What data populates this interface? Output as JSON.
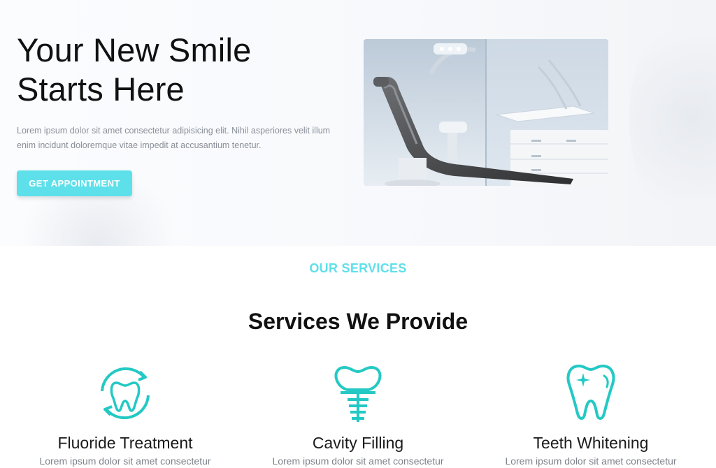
{
  "hero": {
    "title_line1": "Your New Smile",
    "title_line2": "Starts Here",
    "text_line1": "Lorem ipsum dolor sit amet consectetur adipisicing elit. Nihil asperiores velit illum",
    "text_line2": "enim incidunt doloremque vitae impedit at accusantium tenetur.",
    "button_label": "GET APPOINTMENT",
    "photo_icon": "dental-clinic-chair-photo"
  },
  "services": {
    "kicker": "OUR SERVICES",
    "title": "Services We Provide",
    "items": [
      {
        "name": "Fluoride Treatment",
        "desc": "Lorem ipsum dolor sit amet consectetur",
        "icon": "tooth-refresh-icon"
      },
      {
        "name": "Cavity Filling",
        "desc": "Lorem ipsum dolor sit amet consectetur",
        "icon": "dental-implant-icon"
      },
      {
        "name": "Teeth Whitening",
        "desc": "Lorem ipsum dolor sit amet consectetur",
        "icon": "sparkling-tooth-icon"
      }
    ]
  },
  "colors": {
    "accent": "#5ee0ea",
    "icon_teal": "#24c9c4"
  }
}
